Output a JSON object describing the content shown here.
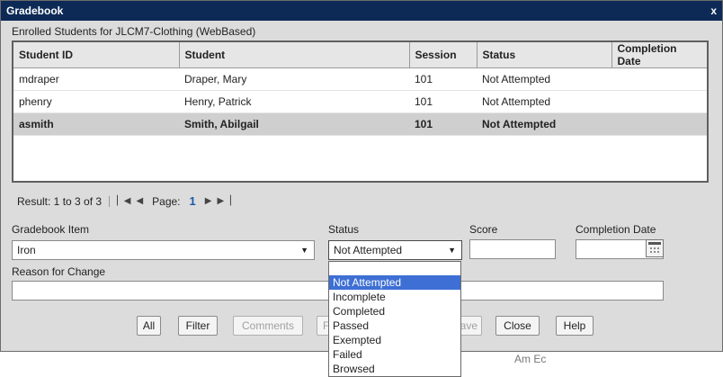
{
  "window": {
    "title": "Gradebook",
    "close_glyph": "x"
  },
  "enrolled_title": "Enrolled Students for JLCM7-Clothing (WebBased)",
  "table": {
    "columns": [
      "Student ID",
      "Student",
      "Session",
      "Status",
      "Completion Date"
    ],
    "rows": [
      {
        "id": "mdraper",
        "name": "Draper, Mary",
        "session": "101",
        "status": "Not Attempted",
        "completion": ""
      },
      {
        "id": "phenry",
        "name": "Henry, Patrick",
        "session": "101",
        "status": "Not Attempted",
        "completion": ""
      },
      {
        "id": "asmith",
        "name": "Smith, Abilgail",
        "session": "101",
        "status": "Not Attempted",
        "completion": "",
        "selected": true
      }
    ]
  },
  "pager": {
    "result_text": "Result: 1 to 3 of 3",
    "page_label": "Page:",
    "page_number": "1",
    "icons": [
      "first-page-icon",
      "prev-page-icon",
      "next-page-icon",
      "last-page-icon"
    ]
  },
  "form": {
    "gradebook_item_label": "Gradebook Item",
    "gradebook_item_value": "Iron",
    "status_label": "Status",
    "status_value": "Not Attempted",
    "score_label": "Score",
    "score_value": "",
    "completion_date_label": "Completion Date",
    "completion_date_value": "",
    "reason_label": "Reason for Change",
    "reason_value": ""
  },
  "status_options": [
    "Not Attempted",
    "Incomplete",
    "Completed",
    "Passed",
    "Exempted",
    "Failed",
    "Browsed"
  ],
  "buttons": {
    "all": "All",
    "filter": "Filter",
    "comments": "Comments",
    "history_partial": "F",
    "save_partial": "ave",
    "close": "Close",
    "help": "Help"
  },
  "background_text": "Am Ec",
  "colors": {
    "titlebar": "#0d2a57",
    "selected_option": "#3d6fd4",
    "page_number": "#1a5ba8"
  }
}
